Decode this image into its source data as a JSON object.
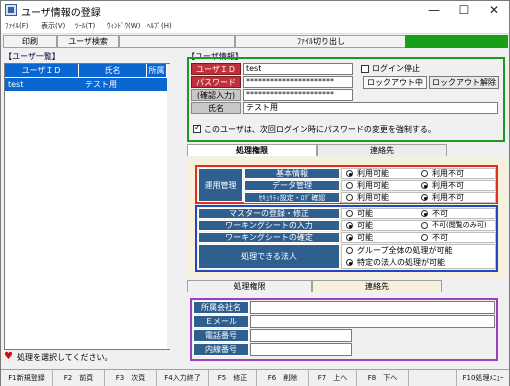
{
  "window": {
    "title": "ユーザ情報の登録",
    "min": "—",
    "max": "☐",
    "close": "✕"
  },
  "menu": [
    "ﾌｧｲﾙ(F)",
    "表示(V)",
    "ﾂｰﾙ(T)",
    "ｳｨﾝﾄﾞｳ(W)",
    "ﾍﾙﾌﾟ(H)"
  ],
  "toolbar": {
    "print": "印刷",
    "user_search": "ユーザ検索",
    "file_switch": "ﾌｧｲﾙ切り出し"
  },
  "left": {
    "caption": "【ユーザ一覧】",
    "columns": [
      "ユーザＩＤ",
      "氏名",
      "所属"
    ],
    "rows": [
      {
        "id": "test",
        "name": "テスト用",
        "dept": ""
      }
    ]
  },
  "right": {
    "caption": "【ユーザ情報】",
    "labels": {
      "user_id": "ユーザＩＤ",
      "password": "パスワード",
      "confirm": "(確認入力)",
      "name": "氏名"
    },
    "values": {
      "user_id": "test",
      "password": "**********************",
      "confirm": "**********************",
      "name": "テスト用"
    },
    "login_stop": "ログイン停止",
    "lockout_status": "ロックアウト中",
    "lockout_release": "ロックアウト解除",
    "force_pw_change": "このユーザは、次回ログイン時にパスワードの変更を強制する。"
  },
  "tabs1": {
    "perm": "処理権限",
    "contact": "連絡先"
  },
  "perm": {
    "group": "運用管理",
    "items": [
      {
        "label": "基本情報",
        "opt1": "利用可能",
        "opt2": "利用不可",
        "sel": 1
      },
      {
        "label": "データ管理",
        "opt1": "利用可能",
        "opt2": "利用不可",
        "sel": 2
      },
      {
        "label": "ｾｷｭﾘﾃｨ設定・ﾛｸﾞ確認",
        "opt1": "利用可能",
        "opt2": "利用不可",
        "sel": 2
      }
    ],
    "master": {
      "label": "マスターの登録・修正",
      "opt1": "可能",
      "opt2": "不可",
      "sel": 2
    },
    "ws_input": {
      "label": "ワーキングシートの入力",
      "opt1": "可能",
      "opt2": "不可(閲覧のみ可)",
      "sel": 1
    },
    "ws_confirm": {
      "label": "ワーキングシートの確定",
      "opt1": "可能",
      "opt2": "不可",
      "sel": 1
    },
    "corp": {
      "label": "処理できる法人",
      "opt1": "グループ全体の処理が可能",
      "opt2": "特定の法人の処理が可能",
      "sel": 2
    }
  },
  "tabs2": {
    "perm": "処理権限",
    "contact": "連絡先"
  },
  "contact": {
    "labels": [
      "所属会社名",
      "Ｅメール",
      "電話番号",
      "内線番号"
    ]
  },
  "status": {
    "message": "処理を選択してください。",
    "heart_color": "#d01010"
  },
  "fkeys": [
    "F1新規登録",
    "F2　前頁",
    "F3　次頁",
    "F4入力終了",
    "F5　修正",
    "F6　削除",
    "F7　上へ",
    "F8　下へ",
    "F10処理ﾒﾆｭｰ"
  ],
  "colors": {
    "green": "#1b9a1b",
    "red": "#e03020",
    "blue": "#2048c0",
    "purple": "#9a40c0",
    "select": "#0a66d1"
  }
}
